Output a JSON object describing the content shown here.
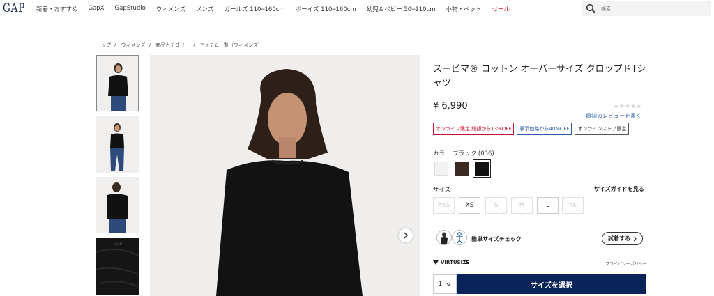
{
  "header": {
    "logo": "GAP",
    "nav": [
      "新着・おすすめ",
      "GapX",
      "GapStudio",
      "ウィメンズ",
      "メンズ",
      "ガールズ 110─160cm",
      "ボーイズ 110─160cm",
      "幼児＆ベビー 50─110cm",
      "小物・ペット",
      "セール"
    ],
    "search_placeholder": "検索"
  },
  "breadcrumb": [
    "トップ",
    "ウィメンズ",
    "商品カテゴリー",
    "アイテム一覧（ウィメンズ）"
  ],
  "product": {
    "title": "スーピマ® コットン オーバーサイズ クロップドTシャツ",
    "price": "¥ 6,990",
    "stars": "★★★★★",
    "review_link": "最初のレビューを書く",
    "badges": [
      "オンライン限定 総額から13%OFF",
      "表示価格から40%OFF",
      "オンラインストア限定"
    ],
    "color_label": "カラー ブラック (036)",
    "swatches": [
      {
        "name": "white",
        "color": "#f2f2f2"
      },
      {
        "name": "brown",
        "color": "#3b2a22"
      },
      {
        "name": "black",
        "color": "#111111"
      }
    ],
    "size_label": "サイズ",
    "size_guide": "サイズガイドを見る",
    "sizes": [
      {
        "label": "XXS",
        "available": false
      },
      {
        "label": "XS",
        "available": true
      },
      {
        "label": "S",
        "available": false
      },
      {
        "label": "M",
        "available": false
      },
      {
        "label": "L",
        "available": true
      },
      {
        "label": "XL",
        "available": false
      }
    ],
    "size_check_title": "簡単サイズチェック",
    "try_button": "試着する",
    "virtusize": "VIRTUSIZE",
    "privacy": "プライバシーポリシー",
    "quantity": "1",
    "select_size_button": "サイズを選択"
  }
}
